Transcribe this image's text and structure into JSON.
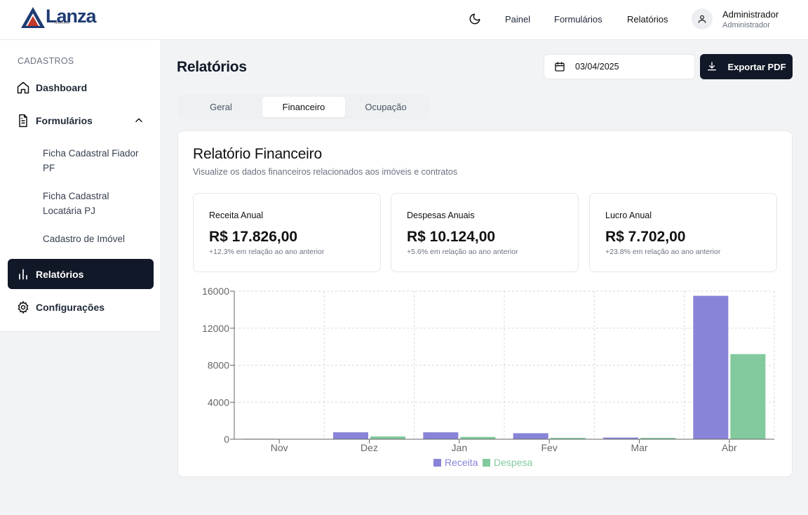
{
  "brand": {
    "name": "Lanza",
    "sub": "imóveis"
  },
  "header": {
    "nav": [
      "Painel",
      "Formulários",
      "Relatórios"
    ],
    "user_name": "Administrador",
    "user_role": "Administrador"
  },
  "sidebar": {
    "section": "CADASTROS",
    "items": {
      "dashboard": "Dashboard",
      "formularios": "Formulários",
      "relatorios": "Relatórios",
      "configuracoes": "Configurações"
    },
    "subitems": [
      "Ficha Cadastral Fiador PF",
      "Ficha Cadastral Locatária PJ",
      "Cadastro de Imóvel"
    ]
  },
  "main": {
    "title": "Relatórios",
    "date": "03/04/2025",
    "export_label": "Exportar PDF",
    "tabs": [
      "Geral",
      "Financeiro",
      "Ocupação"
    ]
  },
  "report": {
    "title": "Relatório Financeiro",
    "subtitle": "Visualize os dados financeiros relacionados aos imóveis e contratos",
    "stats": [
      {
        "label": "Receita Anual",
        "value": "R$ 17.826,00",
        "note": "+12.3% em relação ao ano anterior"
      },
      {
        "label": "Despesas Anuais",
        "value": "R$ 10.124,00",
        "note": "+5.6% em relação ao ano anterior"
      },
      {
        "label": "Lucro Anual",
        "value": "R$ 7.702,00",
        "note": "+23.8% em relação ao ano anterior"
      }
    ]
  },
  "colors": {
    "receita": "#8884d8",
    "despesa": "#82ca9d",
    "dark": "#111827"
  },
  "chart_data": {
    "type": "bar",
    "categories": [
      "Nov",
      "Dez",
      "Jan",
      "Fev",
      "Mar",
      "Abr"
    ],
    "series": [
      {
        "name": "Receita",
        "values": [
          50,
          750,
          750,
          650,
          180,
          15500
        ]
      },
      {
        "name": "Despesa",
        "values": [
          20,
          300,
          250,
          150,
          150,
          9200
        ]
      }
    ],
    "yticks": [
      "0",
      "4000",
      "8000",
      "12000",
      "16000"
    ],
    "ylim": [
      0,
      16000
    ],
    "grid": true,
    "legend": "bottom"
  }
}
